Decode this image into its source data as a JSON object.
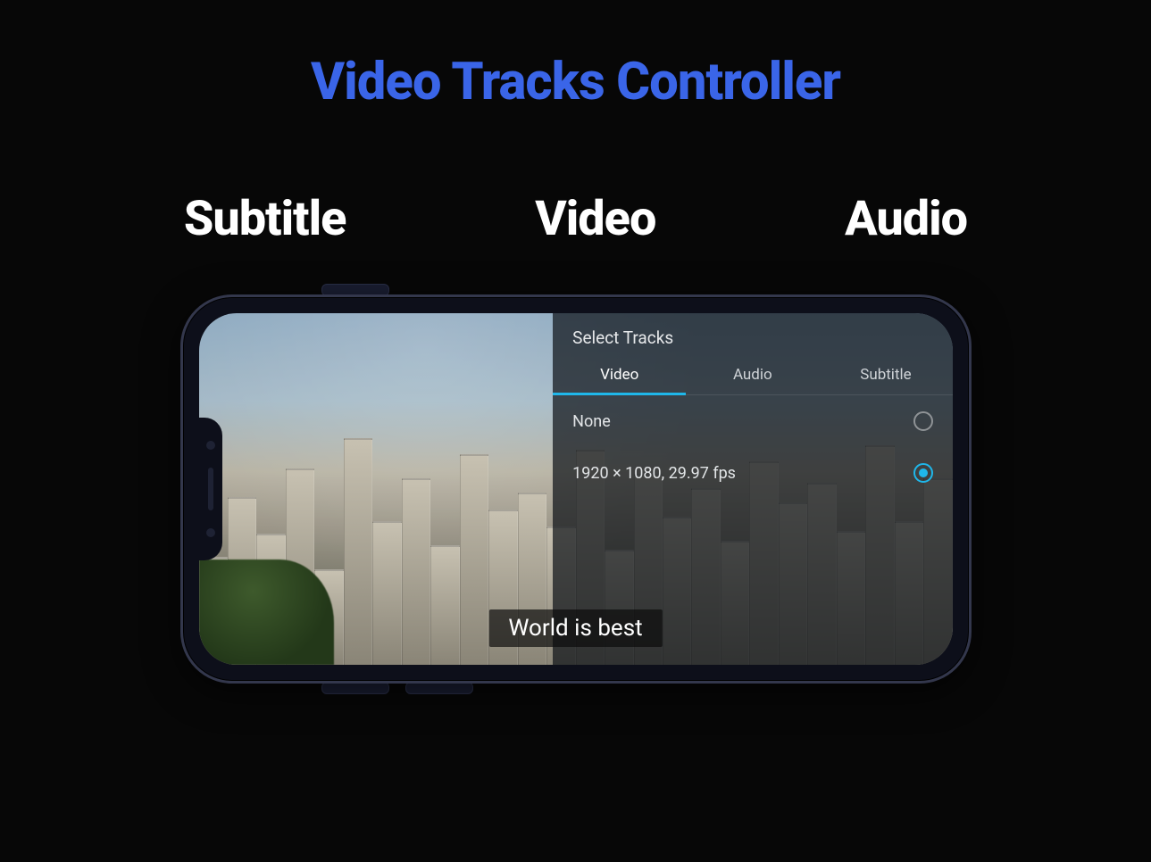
{
  "title": "Video Tracks Controller",
  "headings": {
    "subtitle": "Subtitle",
    "video": "Video",
    "audio": "Audio"
  },
  "panel": {
    "title": "Select Tracks",
    "tabs": {
      "video": {
        "label": "Video",
        "active": true
      },
      "audio": {
        "label": "Audio",
        "active": false
      },
      "subtitle": {
        "label": "Subtitle",
        "active": false
      }
    },
    "options": [
      {
        "label": "None",
        "selected": false
      },
      {
        "label": "1920 × 1080, 29.97 fps",
        "selected": true
      }
    ]
  },
  "subtitle_text": "World is best",
  "colors": {
    "accent": "#1fb7ea",
    "title": "#3a65e8"
  }
}
